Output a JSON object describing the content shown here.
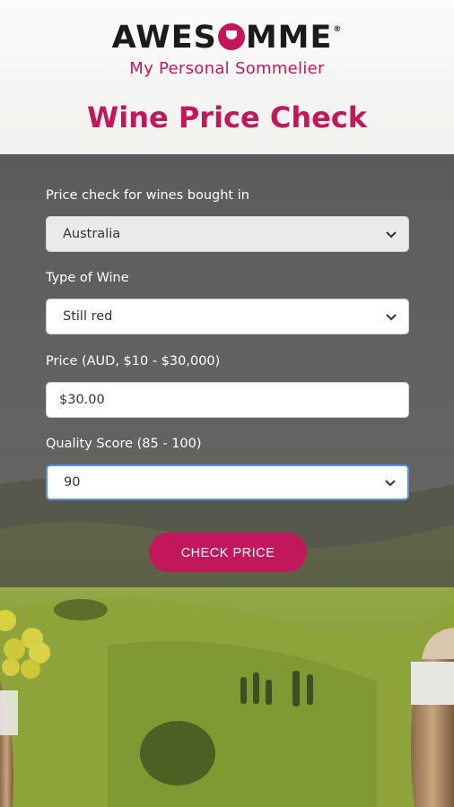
{
  "brand": {
    "logo_prefix": "AWES",
    "logo_suffix": "MME",
    "registered": "®",
    "tagline": "My Personal Sommelier"
  },
  "page": {
    "title": "Wine Price Check"
  },
  "form": {
    "country": {
      "label": "Price check for wines bought in",
      "value": "Australia"
    },
    "wine_type": {
      "label": "Type of Wine",
      "value": "Still red"
    },
    "price": {
      "label": "Price (AUD, $10 - $30,000)",
      "value": "$30.00"
    },
    "quality": {
      "label": "Quality Score (85 - 100)",
      "value": "90"
    },
    "submit_label": "CHECK PRICE"
  },
  "colors": {
    "brand": "#c2185b",
    "panel_overlay": "rgba(70,70,70,0.72)",
    "focus_border": "#5b8fd6"
  },
  "icons": {
    "dropdown": "chevron-down-icon"
  }
}
